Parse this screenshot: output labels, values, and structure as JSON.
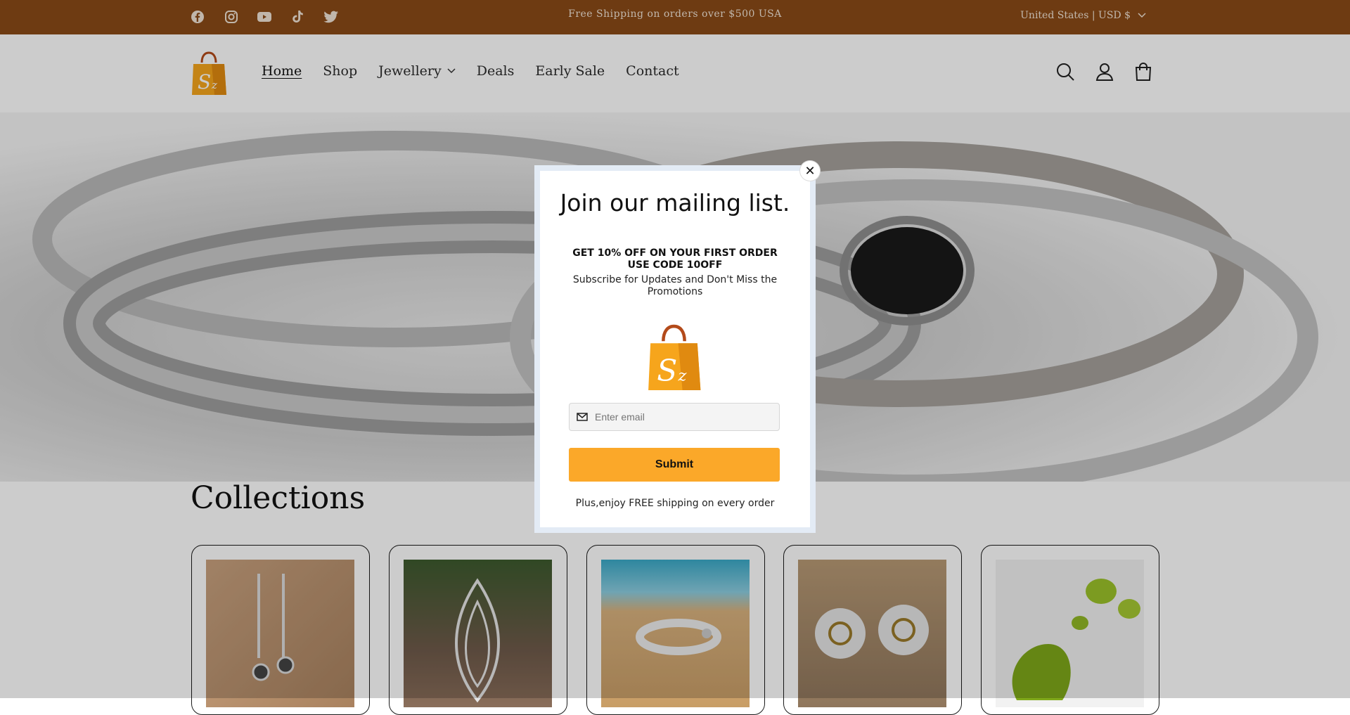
{
  "announcement": {
    "text": "Free Shipping on orders over $500 USA",
    "locale": "United States | USD $",
    "social": [
      "facebook-icon",
      "instagram-icon",
      "youtube-icon",
      "tiktok-icon",
      "twitter-icon"
    ]
  },
  "header": {
    "nav": [
      {
        "label": "Home"
      },
      {
        "label": "Shop"
      },
      {
        "label": "Jewellery"
      },
      {
        "label": "Deals"
      },
      {
        "label": "Early Sale"
      },
      {
        "label": "Contact"
      }
    ],
    "icons": [
      "search-icon",
      "account-icon",
      "cart-icon"
    ]
  },
  "collections": {
    "title": "Collections"
  },
  "popup": {
    "title": "Join our mailing list.",
    "offer": "GET 10% OFF ON YOUR FIRST ORDER USE CODE 10OFF",
    "subtitle": "Subscribe for Updates and Don't Miss the Promotions",
    "email_placeholder": "Enter email",
    "submit_label": "Submit",
    "footer": "Plus,enjoy FREE shipping on every order",
    "close_label": "✕"
  },
  "colors": {
    "announcement_bg": "#8a4a17",
    "submit_bg": "#fba829",
    "modal_border": "#e3ebf5"
  }
}
